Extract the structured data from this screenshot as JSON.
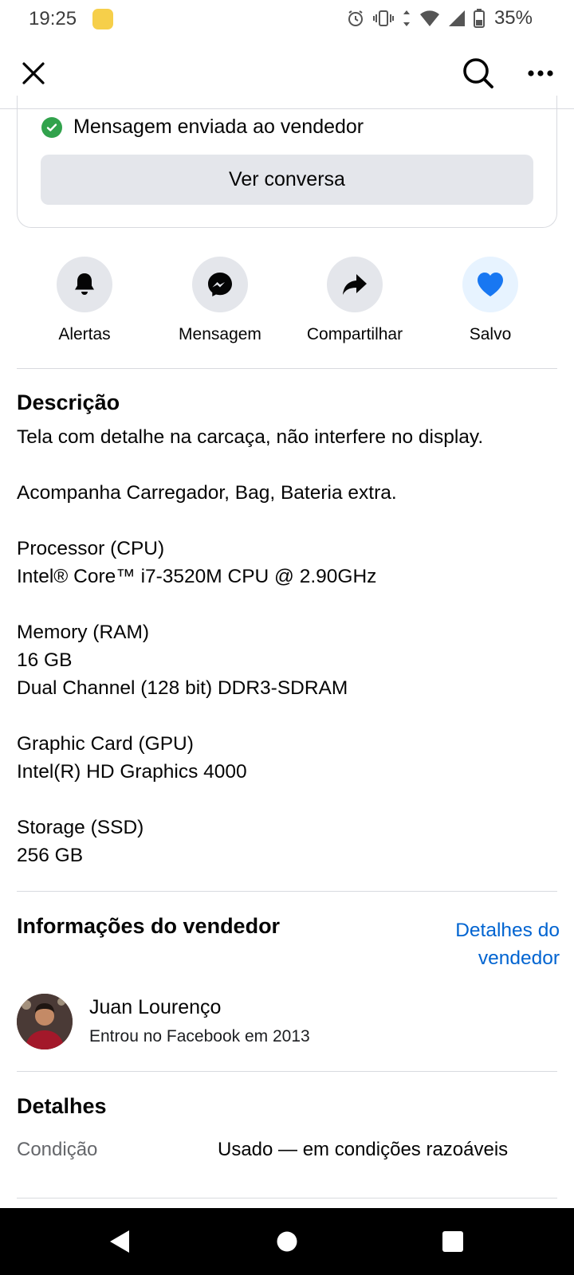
{
  "status_bar": {
    "time": "19:25",
    "battery": "35%",
    "icons": [
      "alarm-icon",
      "vibrate-icon",
      "data-arrows-icon",
      "wifi-icon",
      "signal-icon",
      "battery-icon"
    ]
  },
  "app_bar": {
    "icons": [
      "close-icon",
      "search-icon",
      "more-icon"
    ]
  },
  "sent_card": {
    "message": "Mensagem enviada ao vendedor",
    "button_label": "Ver conversa"
  },
  "actions": [
    {
      "label": "Alertas",
      "icon": "bell-icon"
    },
    {
      "label": "Mensagem",
      "icon": "messenger-icon"
    },
    {
      "label": "Compartilhar",
      "icon": "share-icon"
    },
    {
      "label": "Salvo",
      "icon": "heart-icon"
    }
  ],
  "description": {
    "title": "Descrição",
    "text": "Tela com detalhe na carcaça, não interfere no display.\n\nAcompanha Carregador, Bag, Bateria extra.\n\nProcessor (CPU)\nIntel® Core™ i7-3520M CPU @ 2.90GHz\n\nMemory (RAM)\n16 GB\nDual Channel (128 bit) DDR3-SDRAM\n\nGraphic Card (GPU)\nIntel(R) HD Graphics 4000\n\nStorage (SSD)\n256 GB"
  },
  "seller": {
    "title": "Informações do vendedor",
    "details_link": "Detalhes do vendedor",
    "name": "Juan Lourenço",
    "joined": "Entrou no Facebook em 2013"
  },
  "details": {
    "title": "Detalhes",
    "rows": [
      {
        "key": "Condição",
        "value": "Usado — em condições razoáveis"
      }
    ]
  },
  "nav_bar": {
    "icons": [
      "back-icon",
      "home-icon",
      "recents-icon"
    ]
  },
  "colors": {
    "accent": "#0064d1",
    "saved_heart": "#1877f2",
    "success": "#31a24c",
    "button_bg": "#e4e6eb"
  }
}
